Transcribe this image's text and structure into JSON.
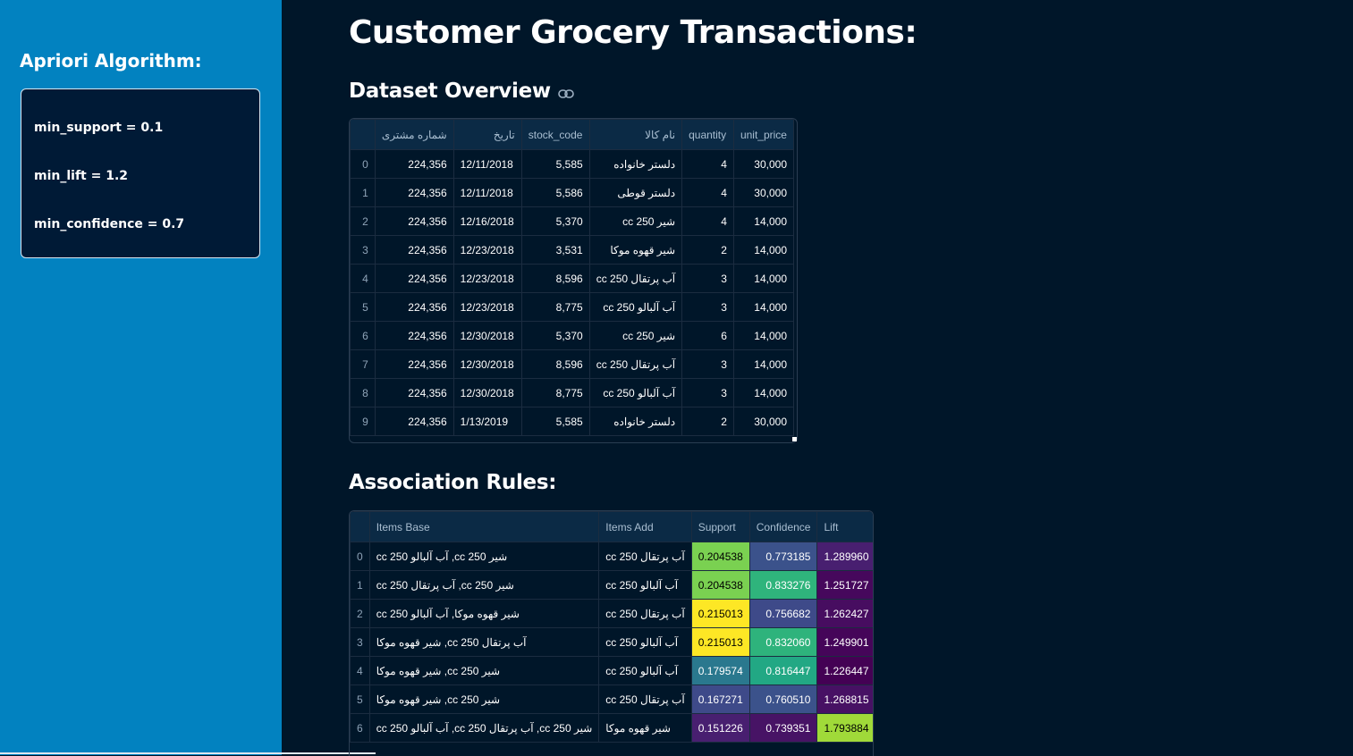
{
  "sidebar": {
    "title": "Apriori Algorithm:",
    "params": [
      "min_support = 0.1",
      "min_lift = 1.2",
      "min_confidence = 0.7"
    ]
  },
  "main": {
    "title": "Customer Grocery Transactions:",
    "dataset_heading": "Dataset Overview",
    "rules_heading": "Association Rules:"
  },
  "dataset": {
    "columns": [
      "",
      "شماره مشتری",
      "تاریخ",
      "stock_code",
      "نام کالا",
      "quantity",
      "unit_price"
    ],
    "rows": [
      [
        "0",
        "224,356",
        "12/11/2018",
        "5,585",
        "دلستر خانواده",
        "4",
        "30,000"
      ],
      [
        "1",
        "224,356",
        "12/11/2018",
        "5,586",
        "دلستر قوطی",
        "4",
        "30,000"
      ],
      [
        "2",
        "224,356",
        "12/16/2018",
        "5,370",
        "شیر 250 cc",
        "4",
        "14,000"
      ],
      [
        "3",
        "224,356",
        "12/23/2018",
        "3,531",
        "شیر قهوه موکا",
        "2",
        "14,000"
      ],
      [
        "4",
        "224,356",
        "12/23/2018",
        "8,596",
        "آب پرتقال 250 cc",
        "3",
        "14,000"
      ],
      [
        "5",
        "224,356",
        "12/23/2018",
        "8,775",
        "آب آلبالو 250 cc",
        "3",
        "14,000"
      ],
      [
        "6",
        "224,356",
        "12/30/2018",
        "5,370",
        "شیر 250 cc",
        "6",
        "14,000"
      ],
      [
        "7",
        "224,356",
        "12/30/2018",
        "8,596",
        "آب پرتقال 250 cc",
        "3",
        "14,000"
      ],
      [
        "8",
        "224,356",
        "12/30/2018",
        "8,775",
        "آب آلبالو 250 cc",
        "3",
        "14,000"
      ],
      [
        "9",
        "224,356",
        "1/13/2019",
        "5,585",
        "دلستر خانواده",
        "2",
        "30,000"
      ]
    ]
  },
  "rules": {
    "columns": [
      "",
      "Items Base",
      "Items Add",
      "Support",
      "Confidence",
      "Lift"
    ],
    "rows": [
      {
        "idx": "0",
        "base": "شیر 250 cc, آب آلبالو 250 cc",
        "add": "آب پرتقال 250 cc",
        "support": "0.204538",
        "confidence": "0.773185",
        "lift": "1.289960",
        "colors": [
          "#7ad151",
          "#3b528b",
          "#481f70"
        ]
      },
      {
        "idx": "1",
        "base": "شیر 250 cc, آب پرتقال 250 cc",
        "add": "آب آلبالو 250 cc",
        "support": "0.204538",
        "confidence": "0.833276",
        "lift": "1.251727",
        "colors": [
          "#7ad151",
          "#2fb47c",
          "#46085c"
        ]
      },
      {
        "idx": "2",
        "base": "شیر قهوه موکا, آب آلبالو 250 cc",
        "add": "آب پرتقال 250 cc",
        "support": "0.215013",
        "confidence": "0.756682",
        "lift": "1.262427",
        "colors": [
          "#fde725",
          "#3e4a89",
          "#470d60"
        ]
      },
      {
        "idx": "3",
        "base": "آب پرتقال 250 cc, شیر قهوه موکا",
        "add": "آب آلبالو 250 cc",
        "support": "0.215013",
        "confidence": "0.832060",
        "lift": "1.249901",
        "colors": [
          "#fde725",
          "#2eb37c",
          "#450559"
        ]
      },
      {
        "idx": "4",
        "base": "شیر 250 cc, شیر قهوه موکا",
        "add": "آب آلبالو 250 cc",
        "support": "0.179574",
        "confidence": "0.816447",
        "lift": "1.226447",
        "colors": [
          "#2a788e",
          "#22a884",
          "#440154"
        ]
      },
      {
        "idx": "5",
        "base": "شیر 250 cc, شیر قهوه موکا",
        "add": "آب پرتقال 250 cc",
        "support": "0.167271",
        "confidence": "0.760510",
        "lift": "1.268815",
        "colors": [
          "#3e4a89",
          "#3b528b",
          "#471164"
        ]
      },
      {
        "idx": "6",
        "base": "شیر 250 cc, آب پرتقال 250 cc, آب آلبالو 250 cc",
        "add": "شیر قهوه موکا",
        "support": "0.151226",
        "confidence": "0.739351",
        "lift": "1.793884",
        "colors": [
          "#481f70",
          "#471365",
          "#a0da39"
        ]
      }
    ]
  }
}
